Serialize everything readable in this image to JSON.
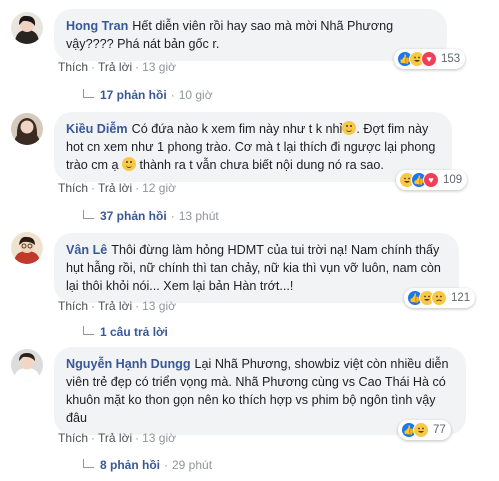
{
  "colors": {
    "author": "#385898",
    "bubble": "#f2f3f5",
    "like": "#1877f2",
    "love": "#f33e58",
    "emoji": "#f7c948"
  },
  "comments": [
    {
      "author": "Hong Tran",
      "text": "Hết diễn viên rồi hay sao mà mời Nhã Phương vậy???? Phá nát bản gốc r.",
      "like_label": "Thích",
      "reply_label": "Trả lời",
      "time": "13 giờ",
      "reactions": [
        "like-icon",
        "haha-icon",
        "love-icon"
      ],
      "reaction_count": "153",
      "replies_count": "17 phản hồi",
      "replies_time": "10 giờ"
    },
    {
      "author": "Kiều Diễm",
      "text_part1": "Có đứa nào k xem fim này như t k nhỉ",
      "text_part2": ". Đợt fim này hot cn xem như 1 phong trào. Cơ mà t lại thích đi ngược lại phong trào cm ạ",
      "text_part3": " thành ra t vẫn chưa biết nội dung nó ra sao.",
      "like_label": "Thích",
      "reply_label": "Trả lời",
      "time": "12 giờ",
      "reactions": [
        "haha-icon",
        "like-icon",
        "love-icon"
      ],
      "reaction_count": "109",
      "replies_count": "37 phản hồi",
      "replies_time": "13 phút"
    },
    {
      "author": "Vân Lê",
      "text": "Thôi đừng làm hỏng HDMT của tui trời nạ! Nam chính thấy hụt hẫng rồi, nữ chính thì tan chảy, nữ kia thì vụn vỡ luôn, nam còn lại thôi khỏi nói... Xem lại bản Hàn trớt...!",
      "like_label": "Thích",
      "reply_label": "Trả lời",
      "time": "13 giờ",
      "reactions": [
        "like-icon",
        "haha-icon",
        "sad-icon"
      ],
      "reaction_count": "121",
      "replies_count": "1 câu trả lời",
      "replies_time": ""
    },
    {
      "author": "Nguyễn Hạnh Dungg",
      "text": "Lại Nhã Phương, showbiz việt còn nhiều diễn viên trẻ đẹp có triển vọng mà. Nhã Phương cùng vs Cao Thái Hà có khuôn mặt ko thon gọn nên ko thích hợp vs phim bộ ngôn tình vậy đâu",
      "like_label": "Thích",
      "reply_label": "Trả lời",
      "time": "13 giờ",
      "reactions": [
        "like-icon",
        "haha-icon"
      ],
      "reaction_count": "77",
      "replies_count": "8 phản hồi",
      "replies_time": "29 phút"
    }
  ]
}
